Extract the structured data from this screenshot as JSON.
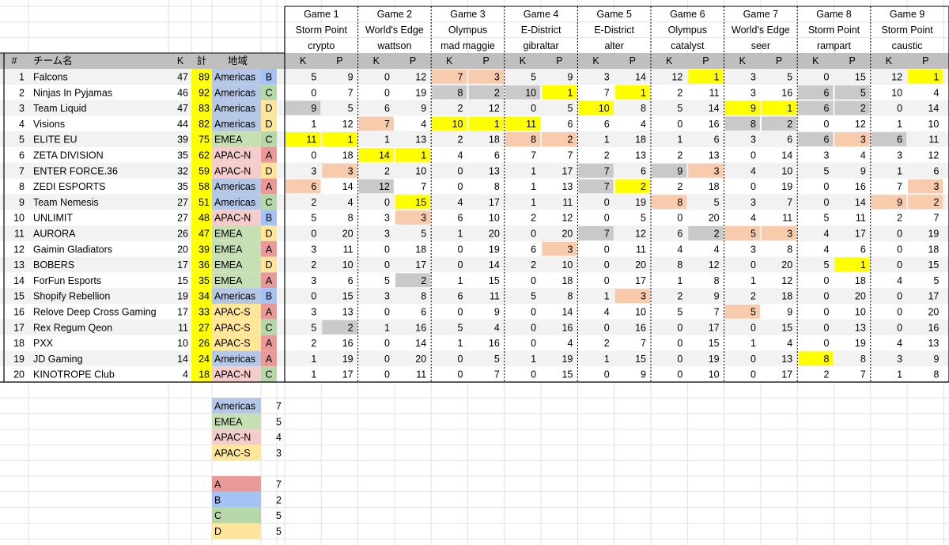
{
  "headers": {
    "hash": "#",
    "team": "チーム名",
    "kills": "K",
    "total": "計",
    "region": "地域",
    "k": "K",
    "p": "P"
  },
  "games": [
    {
      "title": "Game 1",
      "map": "Storm Point",
      "character": "crypto"
    },
    {
      "title": "Game 2",
      "map": "World's Edge",
      "character": "wattson"
    },
    {
      "title": "Game 3",
      "map": "Olympus",
      "character": "mad maggie"
    },
    {
      "title": "Game 4",
      "map": "E-District",
      "character": "gibraltar"
    },
    {
      "title": "Game 5",
      "map": "E-District",
      "character": "alter"
    },
    {
      "title": "Game 6",
      "map": "Olympus",
      "character": "catalyst"
    },
    {
      "title": "Game 7",
      "map": "World's Edge",
      "character": "seer"
    },
    {
      "title": "Game 8",
      "map": "Storm Point",
      "character": "rampart"
    },
    {
      "title": "Game 9",
      "map": "Storm Point",
      "character": "caustic"
    }
  ],
  "teams": [
    {
      "rank": "1",
      "name": "Falcons",
      "kills": "47",
      "total": "89",
      "region": "Americas",
      "group": "B",
      "games": [
        [
          "5",
          "9"
        ],
        [
          "0",
          "12"
        ],
        [
          "7",
          "3"
        ],
        [
          "5",
          "9"
        ],
        [
          "3",
          "14"
        ],
        [
          "12",
          "1"
        ],
        [
          "3",
          "5"
        ],
        [
          "0",
          "15"
        ],
        [
          "12",
          "1"
        ]
      ]
    },
    {
      "rank": "2",
      "name": "Ninjas In Pyjamas",
      "kills": "46",
      "total": "92",
      "region": "Americas",
      "group": "C",
      "games": [
        [
          "0",
          "7"
        ],
        [
          "0",
          "19"
        ],
        [
          "8",
          "2"
        ],
        [
          "10",
          "1"
        ],
        [
          "7",
          "1"
        ],
        [
          "2",
          "11"
        ],
        [
          "3",
          "16"
        ],
        [
          "6",
          "5"
        ],
        [
          "10",
          "4"
        ]
      ]
    },
    {
      "rank": "3",
      "name": "Team Liquid",
      "kills": "47",
      "total": "83",
      "region": "Americas",
      "group": "D",
      "games": [
        [
          "9",
          "5"
        ],
        [
          "6",
          "9"
        ],
        [
          "2",
          "12"
        ],
        [
          "0",
          "5"
        ],
        [
          "10",
          "8"
        ],
        [
          "5",
          "14"
        ],
        [
          "9",
          "1"
        ],
        [
          "6",
          "2"
        ],
        [
          "0",
          "14"
        ]
      ]
    },
    {
      "rank": "4",
      "name": "Visions",
      "kills": "44",
      "total": "82",
      "region": "Americas",
      "group": "D",
      "games": [
        [
          "1",
          "12"
        ],
        [
          "7",
          "4"
        ],
        [
          "10",
          "1"
        ],
        [
          "11",
          "6"
        ],
        [
          "6",
          "4"
        ],
        [
          "0",
          "16"
        ],
        [
          "8",
          "2"
        ],
        [
          "0",
          "12"
        ],
        [
          "1",
          "10"
        ]
      ]
    },
    {
      "rank": "5",
      "name": "ELITE EU",
      "kills": "39",
      "total": "75",
      "region": "EMEA",
      "group": "C",
      "games": [
        [
          "11",
          "1"
        ],
        [
          "1",
          "13"
        ],
        [
          "2",
          "18"
        ],
        [
          "8",
          "2"
        ],
        [
          "1",
          "18"
        ],
        [
          "1",
          "6"
        ],
        [
          "3",
          "6"
        ],
        [
          "6",
          "3"
        ],
        [
          "6",
          "11"
        ]
      ]
    },
    {
      "rank": "6",
      "name": "ZETA DIVISION",
      "kills": "35",
      "total": "62",
      "region": "APAC-N",
      "group": "A",
      "games": [
        [
          "0",
          "18"
        ],
        [
          "14",
          "1"
        ],
        [
          "4",
          "6"
        ],
        [
          "7",
          "7"
        ],
        [
          "2",
          "13"
        ],
        [
          "2",
          "13"
        ],
        [
          "0",
          "14"
        ],
        [
          "3",
          "4"
        ],
        [
          "3",
          "12"
        ]
      ]
    },
    {
      "rank": "7",
      "name": "ENTER FORCE.36",
      "kills": "32",
      "total": "59",
      "region": "APAC-N",
      "group": "D",
      "games": [
        [
          "3",
          "3"
        ],
        [
          "2",
          "10"
        ],
        [
          "0",
          "13"
        ],
        [
          "1",
          "17"
        ],
        [
          "7",
          "6"
        ],
        [
          "9",
          "3"
        ],
        [
          "4",
          "10"
        ],
        [
          "5",
          "9"
        ],
        [
          "1",
          "6"
        ]
      ]
    },
    {
      "rank": "8",
      "name": "ZEDI ESPORTS",
      "kills": "35",
      "total": "58",
      "region": "Americas",
      "group": "A",
      "games": [
        [
          "6",
          "14"
        ],
        [
          "12",
          "7"
        ],
        [
          "0",
          "8"
        ],
        [
          "1",
          "13"
        ],
        [
          "7",
          "2"
        ],
        [
          "2",
          "18"
        ],
        [
          "0",
          "19"
        ],
        [
          "0",
          "16"
        ],
        [
          "7",
          "3"
        ]
      ]
    },
    {
      "rank": "9",
      "name": "Team Nemesis",
      "kills": "27",
      "total": "51",
      "region": "Americas",
      "group": "C",
      "games": [
        [
          "2",
          "4"
        ],
        [
          "0",
          "15"
        ],
        [
          "4",
          "17"
        ],
        [
          "1",
          "11"
        ],
        [
          "0",
          "19"
        ],
        [
          "8",
          "5"
        ],
        [
          "3",
          "7"
        ],
        [
          "0",
          "14"
        ],
        [
          "9",
          "2"
        ]
      ]
    },
    {
      "rank": "10",
      "name": "UNLIMIT",
      "kills": "27",
      "total": "48",
      "region": "APAC-N",
      "group": "B",
      "games": [
        [
          "5",
          "8"
        ],
        [
          "3",
          "3"
        ],
        [
          "6",
          "10"
        ],
        [
          "2",
          "12"
        ],
        [
          "0",
          "5"
        ],
        [
          "0",
          "20"
        ],
        [
          "4",
          "11"
        ],
        [
          "5",
          "11"
        ],
        [
          "2",
          "7"
        ]
      ]
    },
    {
      "rank": "11",
      "name": "AURORA",
      "kills": "26",
      "total": "47",
      "region": "EMEA",
      "group": "D",
      "games": [
        [
          "0",
          "20"
        ],
        [
          "3",
          "5"
        ],
        [
          "1",
          "20"
        ],
        [
          "0",
          "20"
        ],
        [
          "7",
          "12"
        ],
        [
          "6",
          "2"
        ],
        [
          "5",
          "3"
        ],
        [
          "4",
          "17"
        ],
        [
          "0",
          "19"
        ]
      ]
    },
    {
      "rank": "12",
      "name": "Gaimin Gladiators",
      "kills": "20",
      "total": "39",
      "region": "EMEA",
      "group": "A",
      "games": [
        [
          "3",
          "11"
        ],
        [
          "0",
          "18"
        ],
        [
          "0",
          "19"
        ],
        [
          "6",
          "3"
        ],
        [
          "0",
          "11"
        ],
        [
          "4",
          "4"
        ],
        [
          "3",
          "8"
        ],
        [
          "4",
          "6"
        ],
        [
          "0",
          "18"
        ]
      ]
    },
    {
      "rank": "13",
      "name": "BOBERS",
      "kills": "17",
      "total": "36",
      "region": "EMEA",
      "group": "D",
      "games": [
        [
          "2",
          "10"
        ],
        [
          "0",
          "17"
        ],
        [
          "0",
          "14"
        ],
        [
          "2",
          "10"
        ],
        [
          "0",
          "20"
        ],
        [
          "8",
          "12"
        ],
        [
          "0",
          "20"
        ],
        [
          "5",
          "1"
        ],
        [
          "0",
          "15"
        ]
      ]
    },
    {
      "rank": "14",
      "name": "ForFun Esports",
      "kills": "15",
      "total": "35",
      "region": "EMEA",
      "group": "A",
      "games": [
        [
          "3",
          "6"
        ],
        [
          "5",
          "2"
        ],
        [
          "1",
          "15"
        ],
        [
          "0",
          "18"
        ],
        [
          "0",
          "17"
        ],
        [
          "1",
          "8"
        ],
        [
          "1",
          "12"
        ],
        [
          "0",
          "18"
        ],
        [
          "4",
          "5"
        ]
      ]
    },
    {
      "rank": "15",
      "name": "Shopify Rebellion",
      "kills": "19",
      "total": "34",
      "region": "Americas",
      "group": "B",
      "games": [
        [
          "0",
          "15"
        ],
        [
          "3",
          "8"
        ],
        [
          "6",
          "11"
        ],
        [
          "5",
          "8"
        ],
        [
          "1",
          "3"
        ],
        [
          "2",
          "9"
        ],
        [
          "2",
          "18"
        ],
        [
          "0",
          "20"
        ],
        [
          "0",
          "17"
        ]
      ]
    },
    {
      "rank": "16",
      "name": "Relove Deep Cross Gaming",
      "kills": "17",
      "total": "33",
      "region": "APAC-S",
      "group": "A",
      "games": [
        [
          "3",
          "13"
        ],
        [
          "0",
          "6"
        ],
        [
          "0",
          "9"
        ],
        [
          "0",
          "14"
        ],
        [
          "4",
          "10"
        ],
        [
          "5",
          "7"
        ],
        [
          "5",
          "9"
        ],
        [
          "0",
          "10"
        ],
        [
          "0",
          "20"
        ]
      ]
    },
    {
      "rank": "17",
      "name": "Rex Regum Qeon",
      "kills": "11",
      "total": "27",
      "region": "APAC-S",
      "group": "C",
      "games": [
        [
          "5",
          "2"
        ],
        [
          "1",
          "16"
        ],
        [
          "5",
          "4"
        ],
        [
          "0",
          "16"
        ],
        [
          "0",
          "16"
        ],
        [
          "0",
          "17"
        ],
        [
          "0",
          "15"
        ],
        [
          "0",
          "13"
        ],
        [
          "0",
          "16"
        ]
      ]
    },
    {
      "rank": "18",
      "name": "PXX",
      "kills": "10",
      "total": "26",
      "region": "APAC-S",
      "group": "A",
      "games": [
        [
          "2",
          "16"
        ],
        [
          "0",
          "14"
        ],
        [
          "1",
          "16"
        ],
        [
          "0",
          "4"
        ],
        [
          "2",
          "7"
        ],
        [
          "0",
          "15"
        ],
        [
          "1",
          "4"
        ],
        [
          "0",
          "19"
        ],
        [
          "4",
          "13"
        ]
      ]
    },
    {
      "rank": "19",
      "name": "JD Gaming",
      "kills": "14",
      "total": "24",
      "region": "Americas",
      "group": "A",
      "games": [
        [
          "1",
          "19"
        ],
        [
          "0",
          "20"
        ],
        [
          "0",
          "5"
        ],
        [
          "1",
          "19"
        ],
        [
          "1",
          "15"
        ],
        [
          "0",
          "19"
        ],
        [
          "0",
          "13"
        ],
        [
          "8",
          "8"
        ],
        [
          "3",
          "9"
        ]
      ]
    },
    {
      "rank": "20",
      "name": "KINOTROPE Club",
      "kills": "4",
      "total": "18",
      "region": "APAC-N",
      "group": "C",
      "games": [
        [
          "1",
          "17"
        ],
        [
          "0",
          "11"
        ],
        [
          "0",
          "7"
        ],
        [
          "0",
          "15"
        ],
        [
          "0",
          "9"
        ],
        [
          "0",
          "10"
        ],
        [
          "0",
          "17"
        ],
        [
          "2",
          "7"
        ],
        [
          "1",
          "8"
        ]
      ]
    }
  ],
  "highlights": {
    "yellow": [
      "0-5-1",
      "0-8-1",
      "1-3-1",
      "1-4-1",
      "2-4-0",
      "2-6-0",
      "2-6-1",
      "3-2-0",
      "3-2-1",
      "3-3-0",
      "4-0-0",
      "4-0-1",
      "5-1-0",
      "5-1-1",
      "7-4-1",
      "12-7-1",
      "18-7-0",
      "8-1-1"
    ],
    "orange": [
      "0-2-0",
      "0-2-1",
      "3-1-0",
      "4-3-0",
      "4-3-1",
      "4-7-1",
      "6-0-1",
      "6-5-1",
      "7-0-0",
      "8-5-0",
      "8-8-0",
      "9-1-1",
      "10-6-0",
      "10-6-1",
      "11-3-1",
      "14-4-1",
      "15-6-0",
      "7-8-1",
      "8-8-1"
    ],
    "gray": [
      "1-2-0",
      "1-2-1",
      "1-3-0",
      "1-7-0",
      "1-7-1",
      "2-0-0",
      "2-7-0",
      "2-7-1",
      "3-6-0",
      "3-6-1",
      "4-7-0",
      "4-8-0",
      "6-4-0",
      "6-5-0",
      "7-1-0",
      "7-4-0",
      "10-4-0",
      "10-5-1",
      "13-1-1",
      "16-0-1"
    ]
  },
  "region_summary": [
    {
      "label": "Americas",
      "count": "7"
    },
    {
      "label": "EMEA",
      "count": "5"
    },
    {
      "label": "APAC-N",
      "count": "4"
    },
    {
      "label": "APAC-S",
      "count": "3"
    }
  ],
  "group_summary": [
    {
      "label": "A",
      "count": "7"
    },
    {
      "label": "B",
      "count": "2"
    },
    {
      "label": "C",
      "count": "5"
    },
    {
      "label": "D",
      "count": "5"
    }
  ],
  "colors": {
    "yellow": "#ffff00",
    "orange": "#f8cbad",
    "gray": "#c9c9c9",
    "header_gray": "#bfbfbf",
    "total_yellow": "#ffff00",
    "Americas": "#b4c7e7",
    "EMEA": "#c6e0b4",
    "APAC-N": "#f4cccc",
    "APAC-S": "#ffe699",
    "A": "#ea9999",
    "B": "#a4c2f4",
    "C": "#b6d7a8",
    "D": "#ffe599"
  }
}
